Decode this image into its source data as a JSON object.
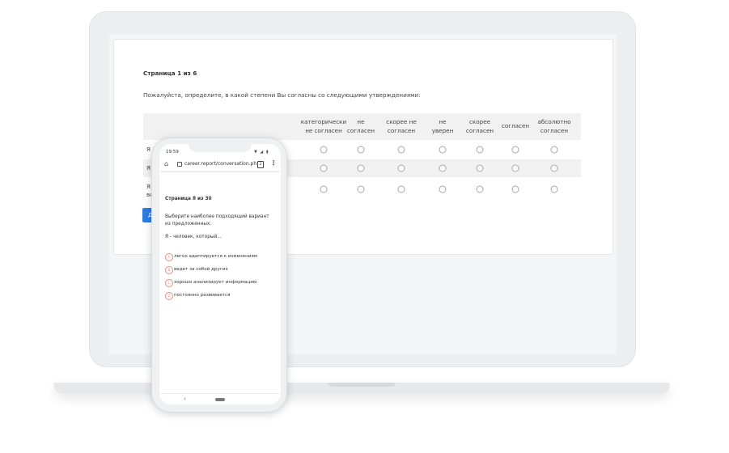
{
  "desktop": {
    "page_title": "Страница 1 из 6",
    "question": "Пожалуйста, определите, в какой степени Вы согласны со следующими утверждениями:",
    "columns": [
      "категорически\nне согласен",
      "не\nсогласен",
      "скорее не\nсогласен",
      "не\nуверен",
      "скорее\nсогласен",
      "согласен",
      "абсолютно\nсогласен"
    ],
    "row_labels": [
      "Я",
      "Я",
      "Я",
      "вс"
    ],
    "button_label": "Д"
  },
  "mobile": {
    "time": "19:59",
    "status_icons": "▼ ◢ ▮",
    "url": "career.report/conversation.ph",
    "tabs_count": "2",
    "page_title": "Страница 8 из 30",
    "question": "Выберите наиболее подходящий вариант из предложенных.",
    "subtitle": "Я - человек, который...",
    "options": [
      {
        "letter": "A",
        "text": "легко адаптируется к изменениям"
      },
      {
        "letter": "B",
        "text": "ведет за собой других"
      },
      {
        "letter": "C",
        "text": "хорошо анализирует информацию"
      },
      {
        "letter": "D",
        "text": "постоянно развивается"
      }
    ]
  },
  "colors": {
    "accent_blue": "#2f7be0",
    "option_outline": "#f08a7a"
  }
}
